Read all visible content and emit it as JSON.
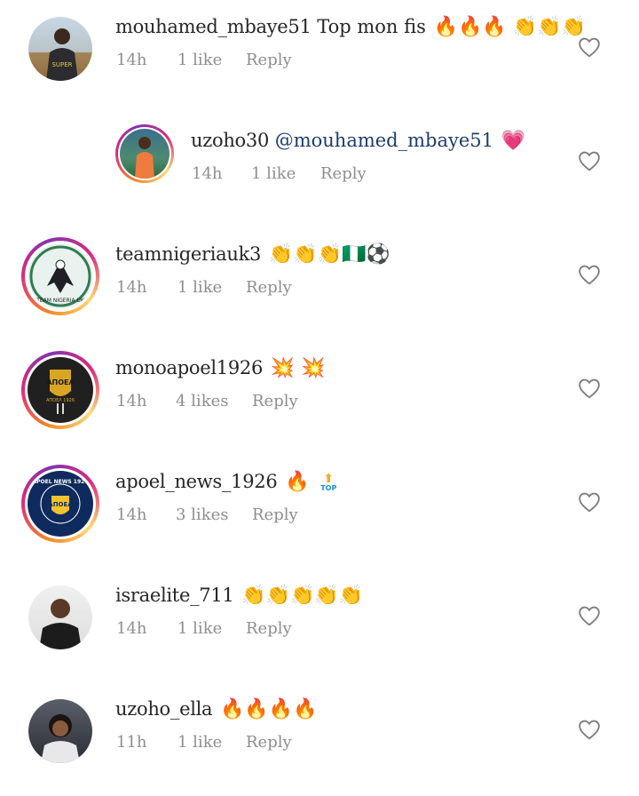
{
  "comments": [
    {
      "username": "mouhamed_mbaye51",
      "text": "Top mon fis",
      "mention": "",
      "emoji": "🔥🔥🔥 👏👏👏",
      "time": "14h",
      "likes": "1 like",
      "reply": "Reply"
    },
    {
      "username": "uzoho30",
      "text": "",
      "mention": "@mouhamed_mbaye51",
      "emoji": "💗",
      "time": "14h",
      "likes": "1 like",
      "reply": "Reply"
    },
    {
      "username": "teamnigeriauk3",
      "text": "",
      "mention": "",
      "emoji": "👏👏👏🇳🇬⚽",
      "time": "14h",
      "likes": "1 like",
      "reply": "Reply"
    },
    {
      "username": "monoapoel1926",
      "text": "",
      "mention": "",
      "emoji": "💥 💥",
      "time": "14h",
      "likes": "4 likes",
      "reply": "Reply"
    },
    {
      "username": "apoel_news_1926",
      "text": "",
      "mention": "",
      "emoji": "🔥",
      "badge": "TOP",
      "time": "14h",
      "likes": "3 likes",
      "reply": "Reply"
    },
    {
      "username": "israelite_711",
      "text": "",
      "mention": "",
      "emoji": "👏👏👏👏👏",
      "time": "14h",
      "likes": "1 like",
      "reply": "Reply"
    },
    {
      "username": "uzoho_ella",
      "text": "",
      "mention": "",
      "emoji": "🔥🔥🔥🔥",
      "time": "11h",
      "likes": "1 like",
      "reply": "Reply"
    }
  ],
  "avatars": {
    "team_logo_text": "TEAM NIGERIA UK",
    "mono_logo_text": "ΑΠΟΕΛ",
    "mono_logo_sub": "ΑΠΟΕΛ 1926",
    "news_logo_text": "APOEL NEWS 1926",
    "news_logo_inner": "ΑΠΟΕΛ"
  },
  "icons": {
    "like": "heart-outline-icon"
  },
  "colors": {
    "text": "#262626",
    "meta": "#8e8e8e",
    "mention": "#1b3d6d",
    "ring_start": "#f58529",
    "ring_end": "#dd2a7b"
  }
}
